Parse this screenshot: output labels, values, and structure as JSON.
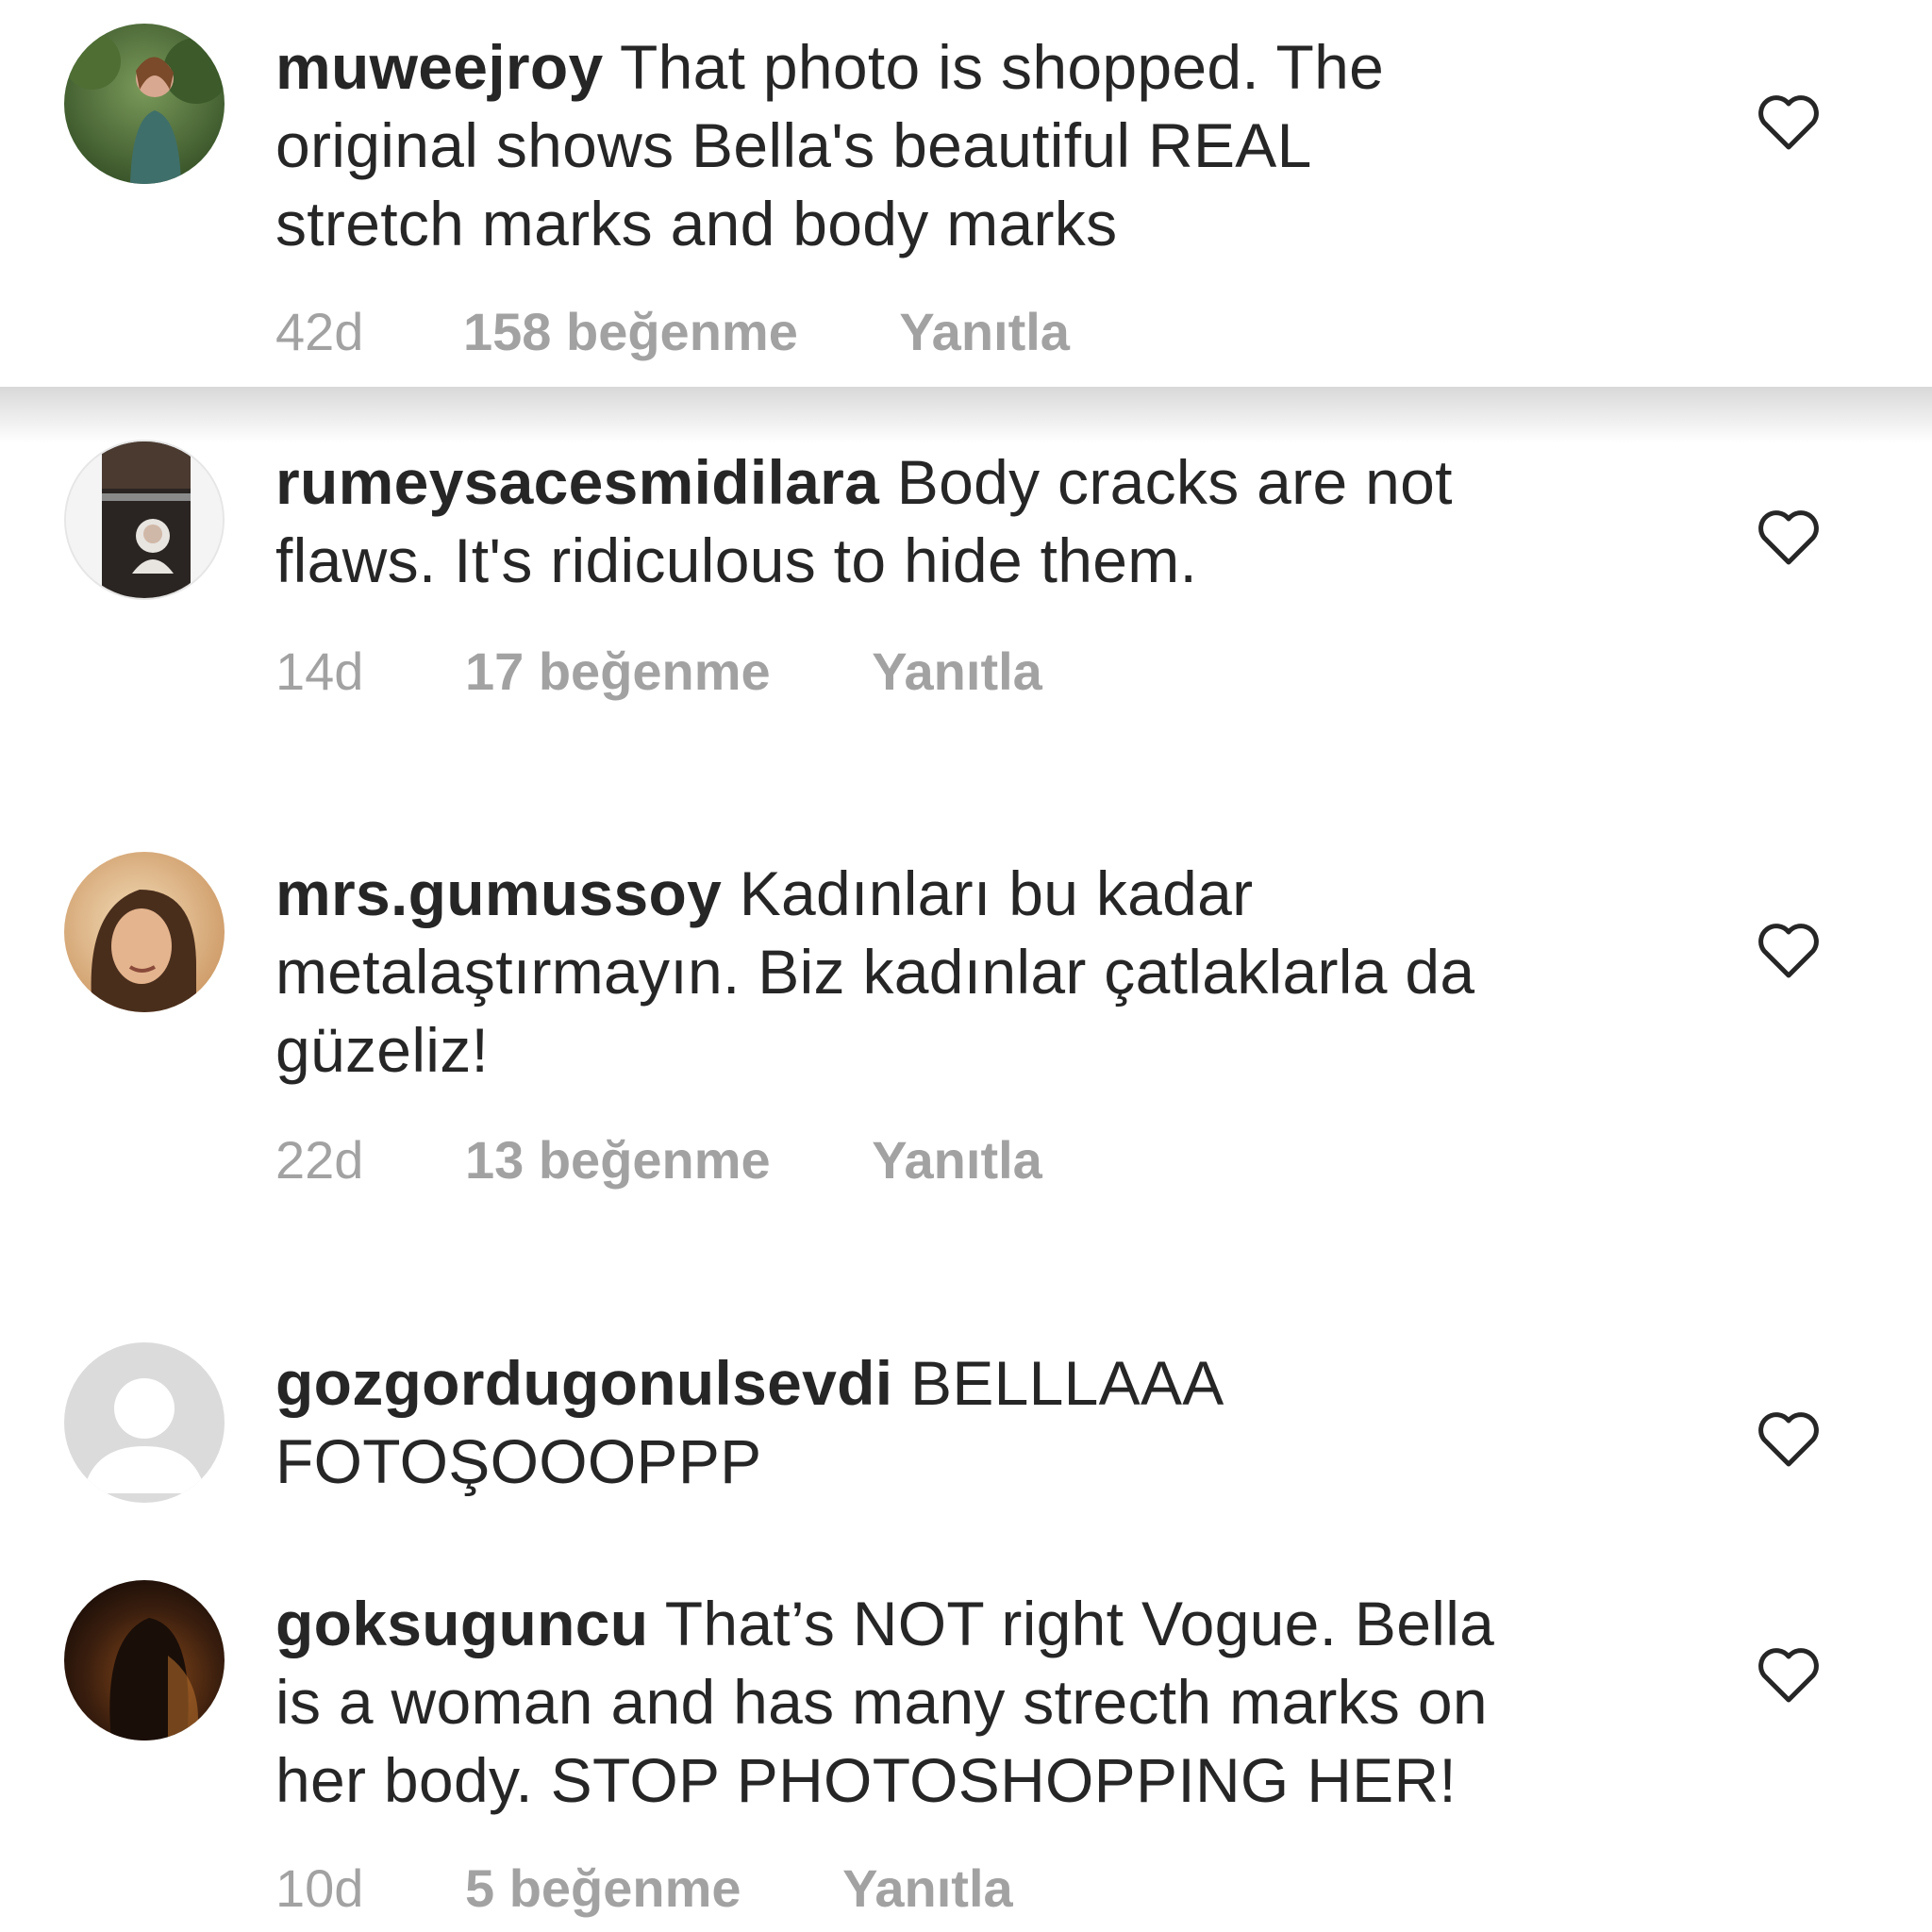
{
  "comments": [
    {
      "username": "muweejroy",
      "text": "That photo is shopped. The original shows Bella's beautiful REAL stretch marks and body marks",
      "lines": [
        "That photo is shopped. The",
        "original shows Bella's beautiful REAL",
        "stretch marks and body marks"
      ],
      "time": "42d",
      "likes": "158 beğenme",
      "reply": "Yanıtla",
      "avatar_icon": "profile-photo-avatar",
      "heart_icon": "heart-outline-icon"
    },
    {
      "username": "rumeysacesmidilara",
      "text": "Body cracks are not flaws. It's ridiculous to hide them.",
      "lines": [
        "Body cracks are not",
        "flaws. It's ridiculous to hide them."
      ],
      "time": "14d",
      "likes": "17 beğenme",
      "reply": "Yanıtla",
      "avatar_icon": "profile-photo-avatar",
      "heart_icon": "heart-outline-icon"
    },
    {
      "username": "mrs.gumussoy",
      "text": "Kadınları bu kadar metalaştırmayın. Biz kadınlar çatlaklarla da güzeliz!",
      "lines": [
        "Kadınları bu kadar",
        "metalaştırmayın. Biz kadınlar çatlaklarla da",
        "güzeliz!"
      ],
      "time": "22d",
      "likes": "13 beğenme",
      "reply": "Yanıtla",
      "avatar_icon": "profile-photo-avatar",
      "heart_icon": "heart-outline-icon"
    },
    {
      "username": "gozgordugonulsevdi",
      "text": "BELLLAAA FOTOŞOOOPPP",
      "lines": [
        "BELLLAAA",
        "FOTOŞOOOPPP"
      ],
      "avatar_icon": "default-user-avatar",
      "heart_icon": "heart-outline-icon"
    },
    {
      "username": "goksuguncu",
      "text": "That’s NOT right Vogue. Bella is a woman and has many strecth marks on her body. STOP PHOTOSHOPPING HER!",
      "lines": [
        "That’s NOT right Vogue. Bella",
        "is a woman and has many strecth marks on",
        "her body. STOP PHOTOSHOPPING HER!"
      ],
      "time": "10d",
      "likes": "5 beğenme",
      "reply": "Yanıtla",
      "avatar_icon": "profile-photo-avatar",
      "heart_icon": "heart-outline-icon"
    }
  ],
  "colors": {
    "text": "#262626",
    "meta": "#a2a2a2",
    "heart_stroke": "#262626",
    "default_avatar_bg": "#dbdbdb"
  }
}
